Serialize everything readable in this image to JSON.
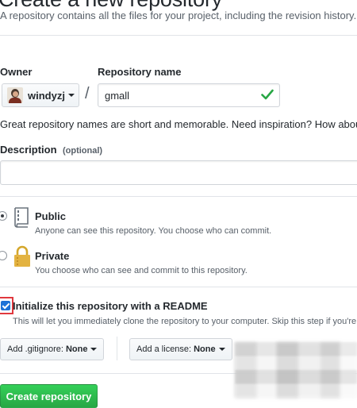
{
  "header": {
    "title": "Create a new repository",
    "subtitle": "A repository contains all the files for your project, including the revision history."
  },
  "owner": {
    "label": "Owner",
    "username": "windyzj"
  },
  "repository": {
    "label": "Repository name",
    "value": "gmall",
    "separator": "/",
    "hint": "Great repository names are short and memorable. Need inspiration? How about"
  },
  "description": {
    "label": "Description",
    "optional": "(optional)",
    "value": ""
  },
  "visibility": {
    "public": {
      "label": "Public",
      "description": "Anyone can see this repository. You choose who can commit.",
      "selected": true
    },
    "private": {
      "label": "Private",
      "description": "You choose who can see and commit to this repository.",
      "selected": false
    }
  },
  "readme": {
    "label": "Initialize this repository with a README",
    "description": "This will let you immediately clone the repository to your computer. Skip this step if you're",
    "checked": true
  },
  "gitignore": {
    "label": "Add .gitignore:",
    "value": "None"
  },
  "license": {
    "label": "Add a license:",
    "value": "None"
  },
  "actions": {
    "create_label": "Create repository"
  },
  "colors": {
    "accent_green": "#28a745",
    "check_green": "#28a745",
    "highlight_red": "#e0383e",
    "checkbox_blue": "#1e73d8"
  },
  "icons": {
    "public": "repo-book-icon",
    "private": "lock-icon",
    "valid": "check-icon"
  }
}
